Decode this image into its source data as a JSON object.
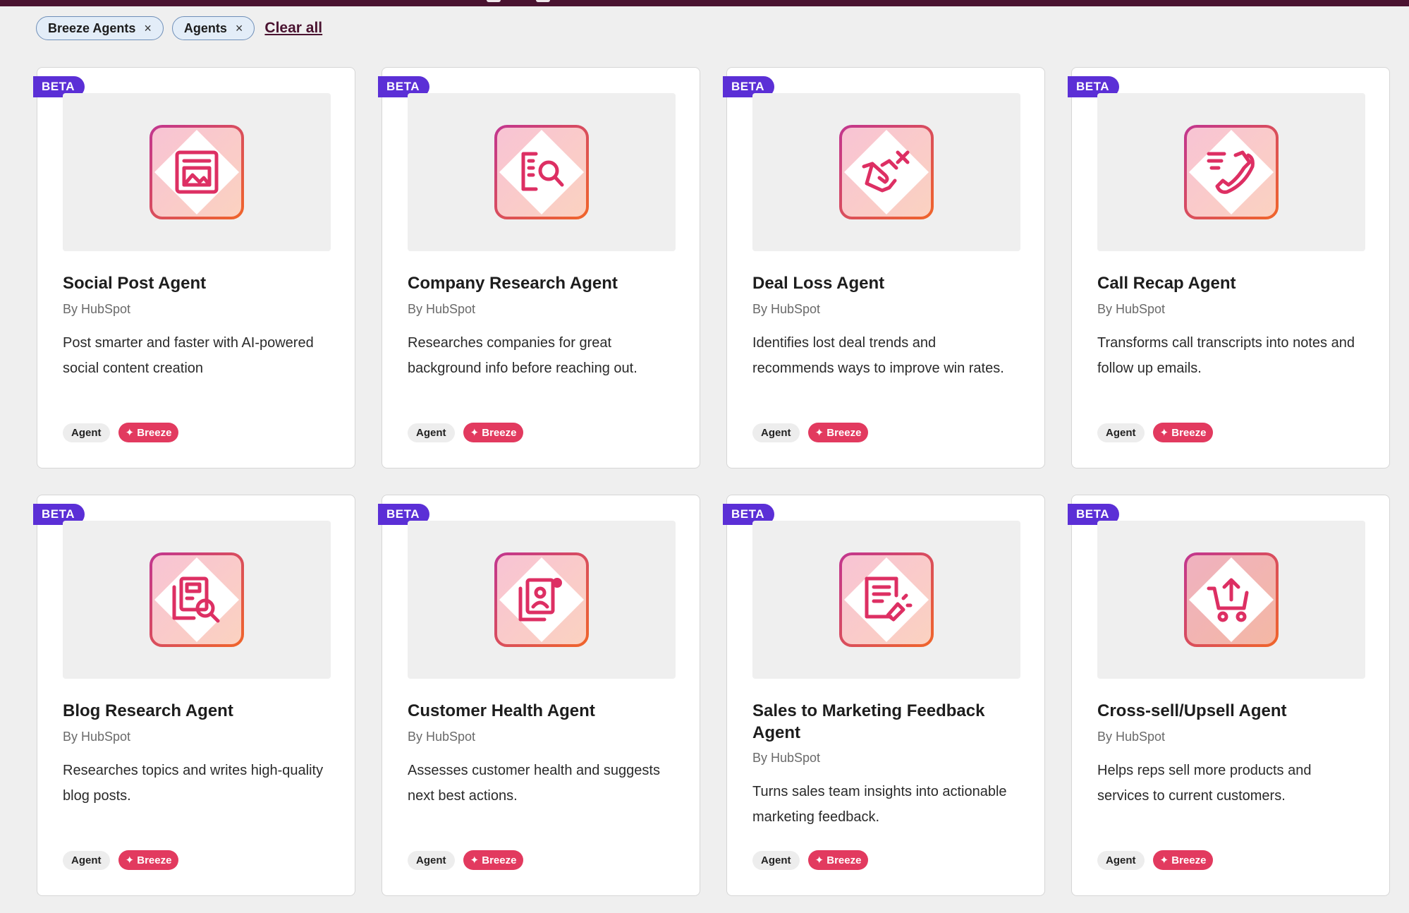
{
  "filters": {
    "chips": [
      {
        "label": "Breeze Agents",
        "remove": "×"
      },
      {
        "label": "Agents",
        "remove": "×"
      }
    ],
    "clear_all": "Clear all"
  },
  "colors": {
    "beta_badge": "#5b2fd6",
    "breeze_tag": "#e23a5f",
    "top_bar": "#4a1330",
    "icon_accent": "#e0315f"
  },
  "cards": [
    {
      "badge": "BETA",
      "title": "Social Post Agent",
      "by": "By HubSpot",
      "description": "Post smarter and faster with AI-powered social content creation",
      "icon": "social-post-icon",
      "tag_agent": "Agent",
      "tag_breeze": "✦ Breeze"
    },
    {
      "badge": "BETA",
      "title": "Company Research Agent",
      "by": "By HubSpot",
      "description": "Researches companies for great background info before reaching out.",
      "icon": "company-research-icon",
      "tag_agent": "Agent",
      "tag_breeze": "✦ Breeze"
    },
    {
      "badge": "BETA",
      "title": "Deal Loss Agent",
      "by": "By HubSpot",
      "description": "Identifies lost deal trends and recommends ways to improve win rates.",
      "icon": "deal-loss-handshake-icon",
      "tag_agent": "Agent",
      "tag_breeze": "✦ Breeze"
    },
    {
      "badge": "BETA",
      "title": "Call Recap Agent",
      "by": "By HubSpot",
      "description": "Transforms call transcripts into notes and follow up emails.",
      "icon": "call-recap-phone-icon",
      "tag_agent": "Agent",
      "tag_breeze": "✦ Breeze"
    },
    {
      "badge": "BETA",
      "title": "Blog Research Agent",
      "by": "By HubSpot",
      "description": "Researches topics and writes high-quality blog posts.",
      "icon": "blog-research-icon",
      "tag_agent": "Agent",
      "tag_breeze": "✦ Breeze"
    },
    {
      "badge": "BETA",
      "title": "Customer Health Agent",
      "by": "By HubSpot",
      "description": "Assesses customer health and suggests next best actions.",
      "icon": "customer-health-icon",
      "tag_agent": "Agent",
      "tag_breeze": "✦ Breeze"
    },
    {
      "badge": "BETA",
      "title": "Sales to Marketing Feedback Agent",
      "by": "By HubSpot",
      "description": "Turns sales team insights into actionable marketing feedback.",
      "icon": "sales-feedback-icon",
      "tag_agent": "Agent",
      "tag_breeze": "✦ Breeze"
    },
    {
      "badge": "BETA",
      "title": "Cross-sell/Upsell Agent",
      "by": "By HubSpot",
      "description": "Helps reps sell more products and services to current customers.",
      "icon": "cart-upsell-icon",
      "tag_agent": "Agent",
      "tag_breeze": "✦ Breeze"
    }
  ]
}
